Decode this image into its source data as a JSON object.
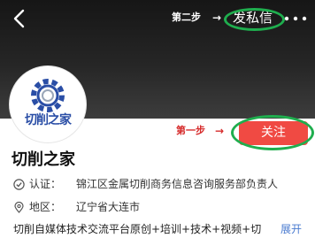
{
  "header": {
    "step2_label": "第二步",
    "arrow": "→",
    "send_message_label": "发私信",
    "back_icon": "chevron-left-icon",
    "more_icon": "more-dots-icon"
  },
  "profile": {
    "avatar_text": "切削之家",
    "name": "切削之家",
    "step1_label": "第一步",
    "arrow": "→",
    "follow_label": "关注",
    "certification": {
      "label": "认证：",
      "value": "锦江区金属切削商务信息咨询服务部负责人",
      "icon": "verified-check-icon"
    },
    "area": {
      "label": "地区：",
      "value": "辽宁省大连市",
      "icon": "location-pin-icon"
    },
    "description": "切削自媒体技术交流平台原创+培训+技术+视频+切",
    "expand_label": "展开"
  },
  "annotation_color": "#1fae4e",
  "accent_color": "#f04a43"
}
